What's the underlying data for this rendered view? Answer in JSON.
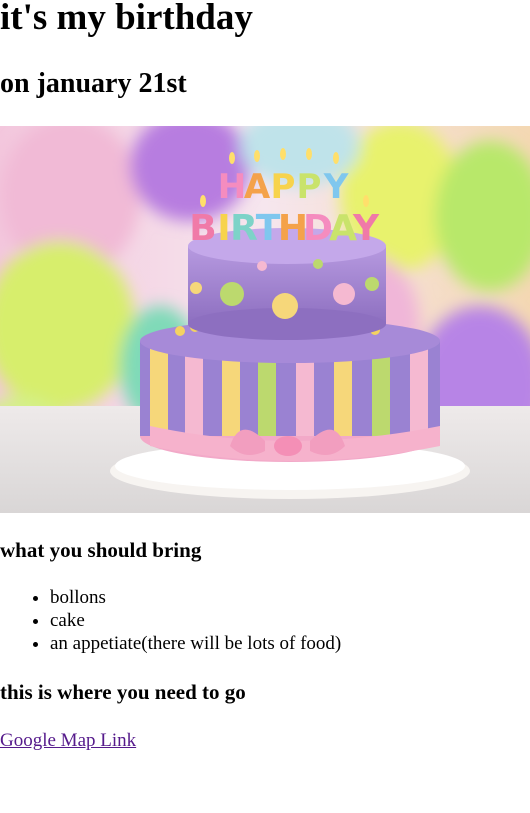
{
  "page": {
    "title": "it's my birthday",
    "date": "on january 21st"
  },
  "image": {
    "description_icon": "birthday-cake-image",
    "banner_letters_top": "HAPPY",
    "banner_letters_bottom": "BIRTHDAY"
  },
  "bring": {
    "heading": "what you should bring",
    "items": [
      "bollons",
      "cake",
      "an appetiate(there will be lots of food)"
    ]
  },
  "location": {
    "heading": "this is where you need to go",
    "link_label": "Google Map Link"
  },
  "colors": {
    "link_visited": "#551a8b",
    "cake_purple": "#9b7fc9",
    "cake_pink": "#f4b6cf",
    "cake_yellow": "#f2d36b",
    "cake_green": "#b5d86a"
  }
}
